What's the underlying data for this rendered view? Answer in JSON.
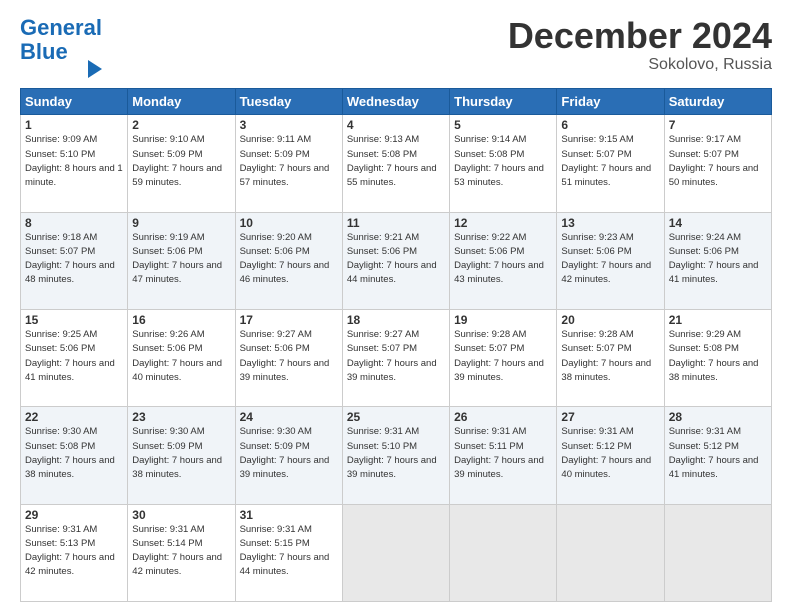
{
  "header": {
    "logo_line1": "General",
    "logo_line2": "Blue",
    "month": "December 2024",
    "location": "Sokolovo, Russia"
  },
  "weekdays": [
    "Sunday",
    "Monday",
    "Tuesday",
    "Wednesday",
    "Thursday",
    "Friday",
    "Saturday"
  ],
  "weeks": [
    [
      {
        "day": "1",
        "sunrise": "Sunrise: 9:09 AM",
        "sunset": "Sunset: 5:10 PM",
        "daylight": "Daylight: 8 hours and 1 minute."
      },
      {
        "day": "2",
        "sunrise": "Sunrise: 9:10 AM",
        "sunset": "Sunset: 5:09 PM",
        "daylight": "Daylight: 7 hours and 59 minutes."
      },
      {
        "day": "3",
        "sunrise": "Sunrise: 9:11 AM",
        "sunset": "Sunset: 5:09 PM",
        "daylight": "Daylight: 7 hours and 57 minutes."
      },
      {
        "day": "4",
        "sunrise": "Sunrise: 9:13 AM",
        "sunset": "Sunset: 5:08 PM",
        "daylight": "Daylight: 7 hours and 55 minutes."
      },
      {
        "day": "5",
        "sunrise": "Sunrise: 9:14 AM",
        "sunset": "Sunset: 5:08 PM",
        "daylight": "Daylight: 7 hours and 53 minutes."
      },
      {
        "day": "6",
        "sunrise": "Sunrise: 9:15 AM",
        "sunset": "Sunset: 5:07 PM",
        "daylight": "Daylight: 7 hours and 51 minutes."
      },
      {
        "day": "7",
        "sunrise": "Sunrise: 9:17 AM",
        "sunset": "Sunset: 5:07 PM",
        "daylight": "Daylight: 7 hours and 50 minutes."
      }
    ],
    [
      {
        "day": "8",
        "sunrise": "Sunrise: 9:18 AM",
        "sunset": "Sunset: 5:07 PM",
        "daylight": "Daylight: 7 hours and 48 minutes."
      },
      {
        "day": "9",
        "sunrise": "Sunrise: 9:19 AM",
        "sunset": "Sunset: 5:06 PM",
        "daylight": "Daylight: 7 hours and 47 minutes."
      },
      {
        "day": "10",
        "sunrise": "Sunrise: 9:20 AM",
        "sunset": "Sunset: 5:06 PM",
        "daylight": "Daylight: 7 hours and 46 minutes."
      },
      {
        "day": "11",
        "sunrise": "Sunrise: 9:21 AM",
        "sunset": "Sunset: 5:06 PM",
        "daylight": "Daylight: 7 hours and 44 minutes."
      },
      {
        "day": "12",
        "sunrise": "Sunrise: 9:22 AM",
        "sunset": "Sunset: 5:06 PM",
        "daylight": "Daylight: 7 hours and 43 minutes."
      },
      {
        "day": "13",
        "sunrise": "Sunrise: 9:23 AM",
        "sunset": "Sunset: 5:06 PM",
        "daylight": "Daylight: 7 hours and 42 minutes."
      },
      {
        "day": "14",
        "sunrise": "Sunrise: 9:24 AM",
        "sunset": "Sunset: 5:06 PM",
        "daylight": "Daylight: 7 hours and 41 minutes."
      }
    ],
    [
      {
        "day": "15",
        "sunrise": "Sunrise: 9:25 AM",
        "sunset": "Sunset: 5:06 PM",
        "daylight": "Daylight: 7 hours and 41 minutes."
      },
      {
        "day": "16",
        "sunrise": "Sunrise: 9:26 AM",
        "sunset": "Sunset: 5:06 PM",
        "daylight": "Daylight: 7 hours and 40 minutes."
      },
      {
        "day": "17",
        "sunrise": "Sunrise: 9:27 AM",
        "sunset": "Sunset: 5:06 PM",
        "daylight": "Daylight: 7 hours and 39 minutes."
      },
      {
        "day": "18",
        "sunrise": "Sunrise: 9:27 AM",
        "sunset": "Sunset: 5:07 PM",
        "daylight": "Daylight: 7 hours and 39 minutes."
      },
      {
        "day": "19",
        "sunrise": "Sunrise: 9:28 AM",
        "sunset": "Sunset: 5:07 PM",
        "daylight": "Daylight: 7 hours and 39 minutes."
      },
      {
        "day": "20",
        "sunrise": "Sunrise: 9:28 AM",
        "sunset": "Sunset: 5:07 PM",
        "daylight": "Daylight: 7 hours and 38 minutes."
      },
      {
        "day": "21",
        "sunrise": "Sunrise: 9:29 AM",
        "sunset": "Sunset: 5:08 PM",
        "daylight": "Daylight: 7 hours and 38 minutes."
      }
    ],
    [
      {
        "day": "22",
        "sunrise": "Sunrise: 9:30 AM",
        "sunset": "Sunset: 5:08 PM",
        "daylight": "Daylight: 7 hours and 38 minutes."
      },
      {
        "day": "23",
        "sunrise": "Sunrise: 9:30 AM",
        "sunset": "Sunset: 5:09 PM",
        "daylight": "Daylight: 7 hours and 38 minutes."
      },
      {
        "day": "24",
        "sunrise": "Sunrise: 9:30 AM",
        "sunset": "Sunset: 5:09 PM",
        "daylight": "Daylight: 7 hours and 39 minutes."
      },
      {
        "day": "25",
        "sunrise": "Sunrise: 9:31 AM",
        "sunset": "Sunset: 5:10 PM",
        "daylight": "Daylight: 7 hours and 39 minutes."
      },
      {
        "day": "26",
        "sunrise": "Sunrise: 9:31 AM",
        "sunset": "Sunset: 5:11 PM",
        "daylight": "Daylight: 7 hours and 39 minutes."
      },
      {
        "day": "27",
        "sunrise": "Sunrise: 9:31 AM",
        "sunset": "Sunset: 5:12 PM",
        "daylight": "Daylight: 7 hours and 40 minutes."
      },
      {
        "day": "28",
        "sunrise": "Sunrise: 9:31 AM",
        "sunset": "Sunset: 5:12 PM",
        "daylight": "Daylight: 7 hours and 41 minutes."
      }
    ],
    [
      {
        "day": "29",
        "sunrise": "Sunrise: 9:31 AM",
        "sunset": "Sunset: 5:13 PM",
        "daylight": "Daylight: 7 hours and 42 minutes."
      },
      {
        "day": "30",
        "sunrise": "Sunrise: 9:31 AM",
        "sunset": "Sunset: 5:14 PM",
        "daylight": "Daylight: 7 hours and 42 minutes."
      },
      {
        "day": "31",
        "sunrise": "Sunrise: 9:31 AM",
        "sunset": "Sunset: 5:15 PM",
        "daylight": "Daylight: 7 hours and 44 minutes."
      },
      null,
      null,
      null,
      null
    ]
  ]
}
